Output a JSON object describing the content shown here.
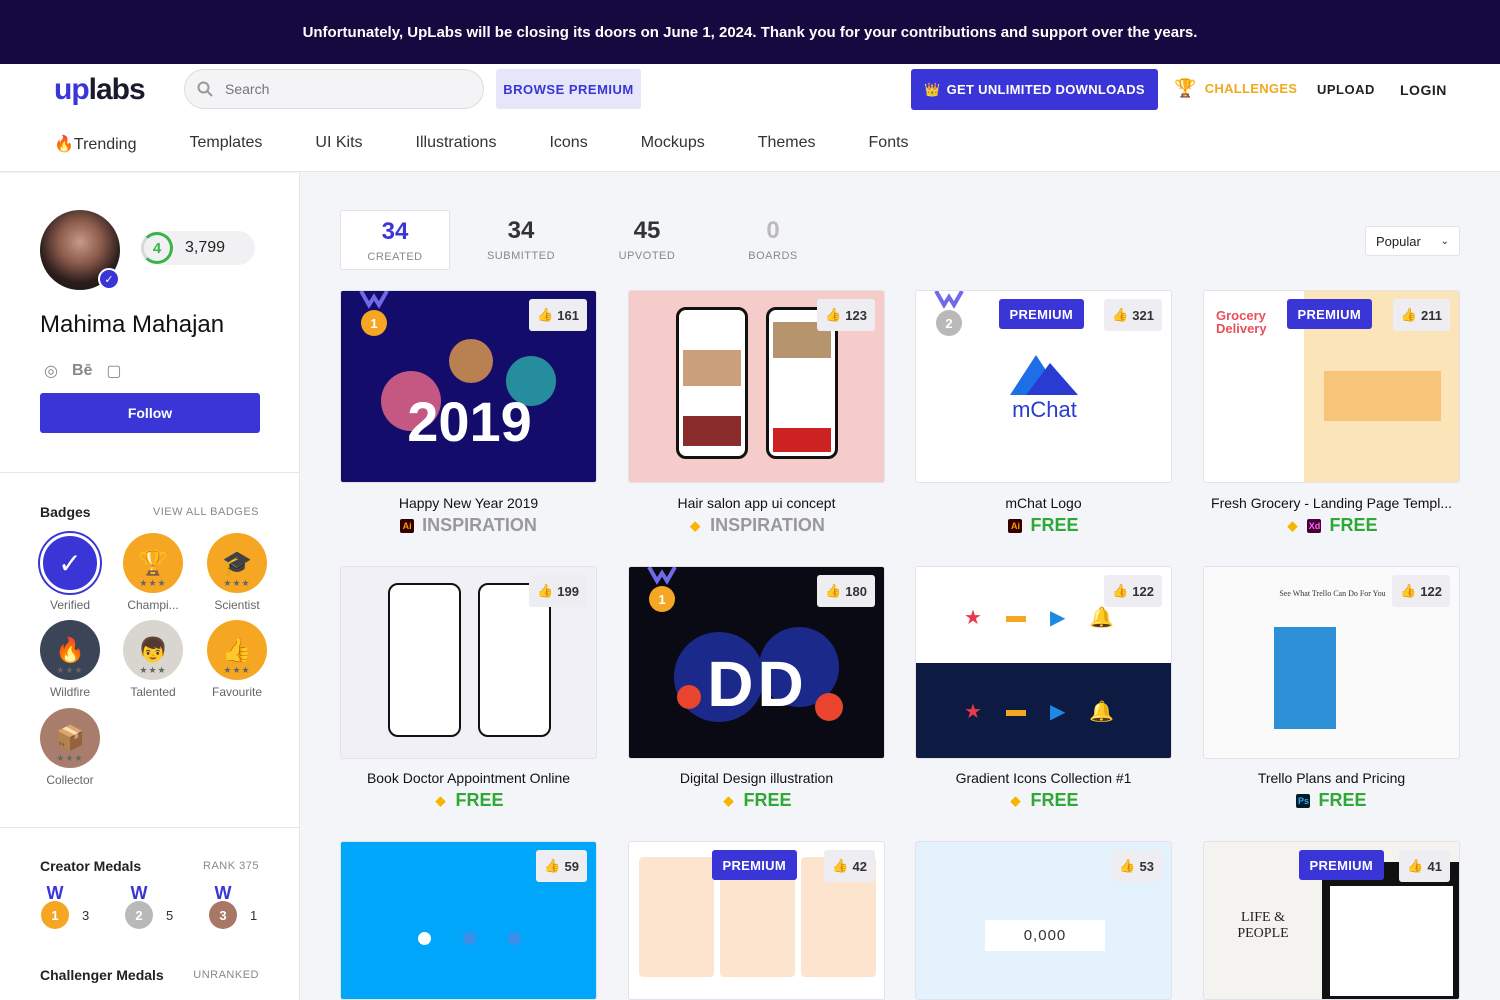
{
  "banner": {
    "text": "Unfortunately, UpLabs will be closing its doors on June 1, 2024. Thank you for your contributions and support over the years."
  },
  "header": {
    "logo_up": "up",
    "logo_labs": "labs",
    "search_placeholder": "Search",
    "browse_premium": "BROWSE PREMIUM",
    "unlimited": "GET UNLIMITED DOWNLOADS",
    "challenges": "CHALLENGES",
    "upload": "UPLOAD",
    "login": "LOGIN",
    "nav": [
      "🔥Trending",
      "Templates",
      "UI Kits",
      "Illustrations",
      "Icons",
      "Mockups",
      "Themes",
      "Fonts"
    ]
  },
  "profile": {
    "level": "4",
    "points": "3,799",
    "name": "Mahima Mahajan",
    "social_behance": "Bē",
    "follow": "Follow"
  },
  "badges": {
    "title": "Badges",
    "view_all": "VIEW ALL BADGES",
    "items": [
      {
        "label": "Verified",
        "icon": "check-icon",
        "color": "#3a35d6"
      },
      {
        "label": "Champi...",
        "icon": "trophy-icon",
        "color": "#f5a623"
      },
      {
        "label": "Scientist",
        "icon": "grad-cap-icon",
        "color": "#f5a623"
      },
      {
        "label": "Wildfire",
        "icon": "fire-icon",
        "color": "#3c4458"
      },
      {
        "label": "Talented",
        "icon": "face-icon",
        "color": "#d9d6cf"
      },
      {
        "label": "Favourite",
        "icon": "thumbs-up-icon",
        "color": "#f5a623"
      },
      {
        "label": "Collector",
        "icon": "box-icon",
        "color": "#a87d6c"
      }
    ]
  },
  "creator_medals": {
    "title": "Creator Medals",
    "rank": "RANK 375",
    "items": [
      {
        "place": "1",
        "count": "3",
        "color": "#f5a623"
      },
      {
        "place": "2",
        "count": "5",
        "color": "#b9b9b9"
      },
      {
        "place": "3",
        "count": "1",
        "color": "#a97766"
      }
    ]
  },
  "challenger_medals": {
    "title": "Challenger Medals",
    "rank": "UNRANKED"
  },
  "stats": [
    {
      "value": "34",
      "label": "CREATED"
    },
    {
      "value": "34",
      "label": "SUBMITTED"
    },
    {
      "value": "45",
      "label": "UPVOTED"
    },
    {
      "value": "0",
      "label": "BOARDS"
    }
  ],
  "sort": {
    "value": "Popular"
  },
  "cards": [
    {
      "title": "Happy New Year 2019",
      "likes": "161",
      "tag": "INSPIRATION",
      "tool": "Ai",
      "premium": false,
      "medal": "1",
      "art": "2019"
    },
    {
      "title": "Hair salon app ui concept",
      "likes": "123",
      "tag": "INSPIRATION",
      "tool": "sketch",
      "premium": false,
      "medal": "",
      "art": ""
    },
    {
      "title": "mChat Logo",
      "likes": "321",
      "tag": "FREE",
      "tool": "Ai",
      "premium": true,
      "medal": "2",
      "art": "mChat"
    },
    {
      "title": "Fresh Grocery - Landing Page Templ...",
      "likes": "211",
      "tag": "FREE",
      "tool": "sketch+xd",
      "premium": true,
      "medal": "",
      "art": "Grocery Delivery"
    },
    {
      "title": "Book Doctor Appointment Online",
      "likes": "199",
      "tag": "FREE",
      "tool": "sketch",
      "premium": false,
      "medal": "",
      "art": ""
    },
    {
      "title": "Digital Design illustration",
      "likes": "180",
      "tag": "FREE",
      "tool": "sketch",
      "premium": false,
      "medal": "1",
      "art": "DD"
    },
    {
      "title": "Gradient Icons Collection #1",
      "likes": "122",
      "tag": "FREE",
      "tool": "sketch",
      "premium": false,
      "medal": "",
      "art": ""
    },
    {
      "title": "Trello Plans and Pricing",
      "likes": "122",
      "tag": "FREE",
      "tool": "Ps",
      "premium": false,
      "medal": "",
      "art": "See What Trello Can Do For You"
    },
    {
      "title": "",
      "likes": "59",
      "tag": "",
      "tool": "",
      "premium": false,
      "medal": "",
      "art": ""
    },
    {
      "title": "",
      "likes": "42",
      "tag": "",
      "tool": "",
      "premium": true,
      "medal": "",
      "art": ""
    },
    {
      "title": "",
      "likes": "53",
      "tag": "",
      "tool": "",
      "premium": false,
      "medal": "",
      "art": "0,000"
    },
    {
      "title": "",
      "likes": "41",
      "tag": "",
      "tool": "",
      "premium": true,
      "medal": "",
      "art": "LIFE & PEOPLE"
    }
  ],
  "premium_label": "PREMIUM",
  "colors": {
    "brand": "#3a35d6",
    "banner": "#140a3f",
    "free": "#2fa836",
    "gold": "#f1a91c"
  }
}
